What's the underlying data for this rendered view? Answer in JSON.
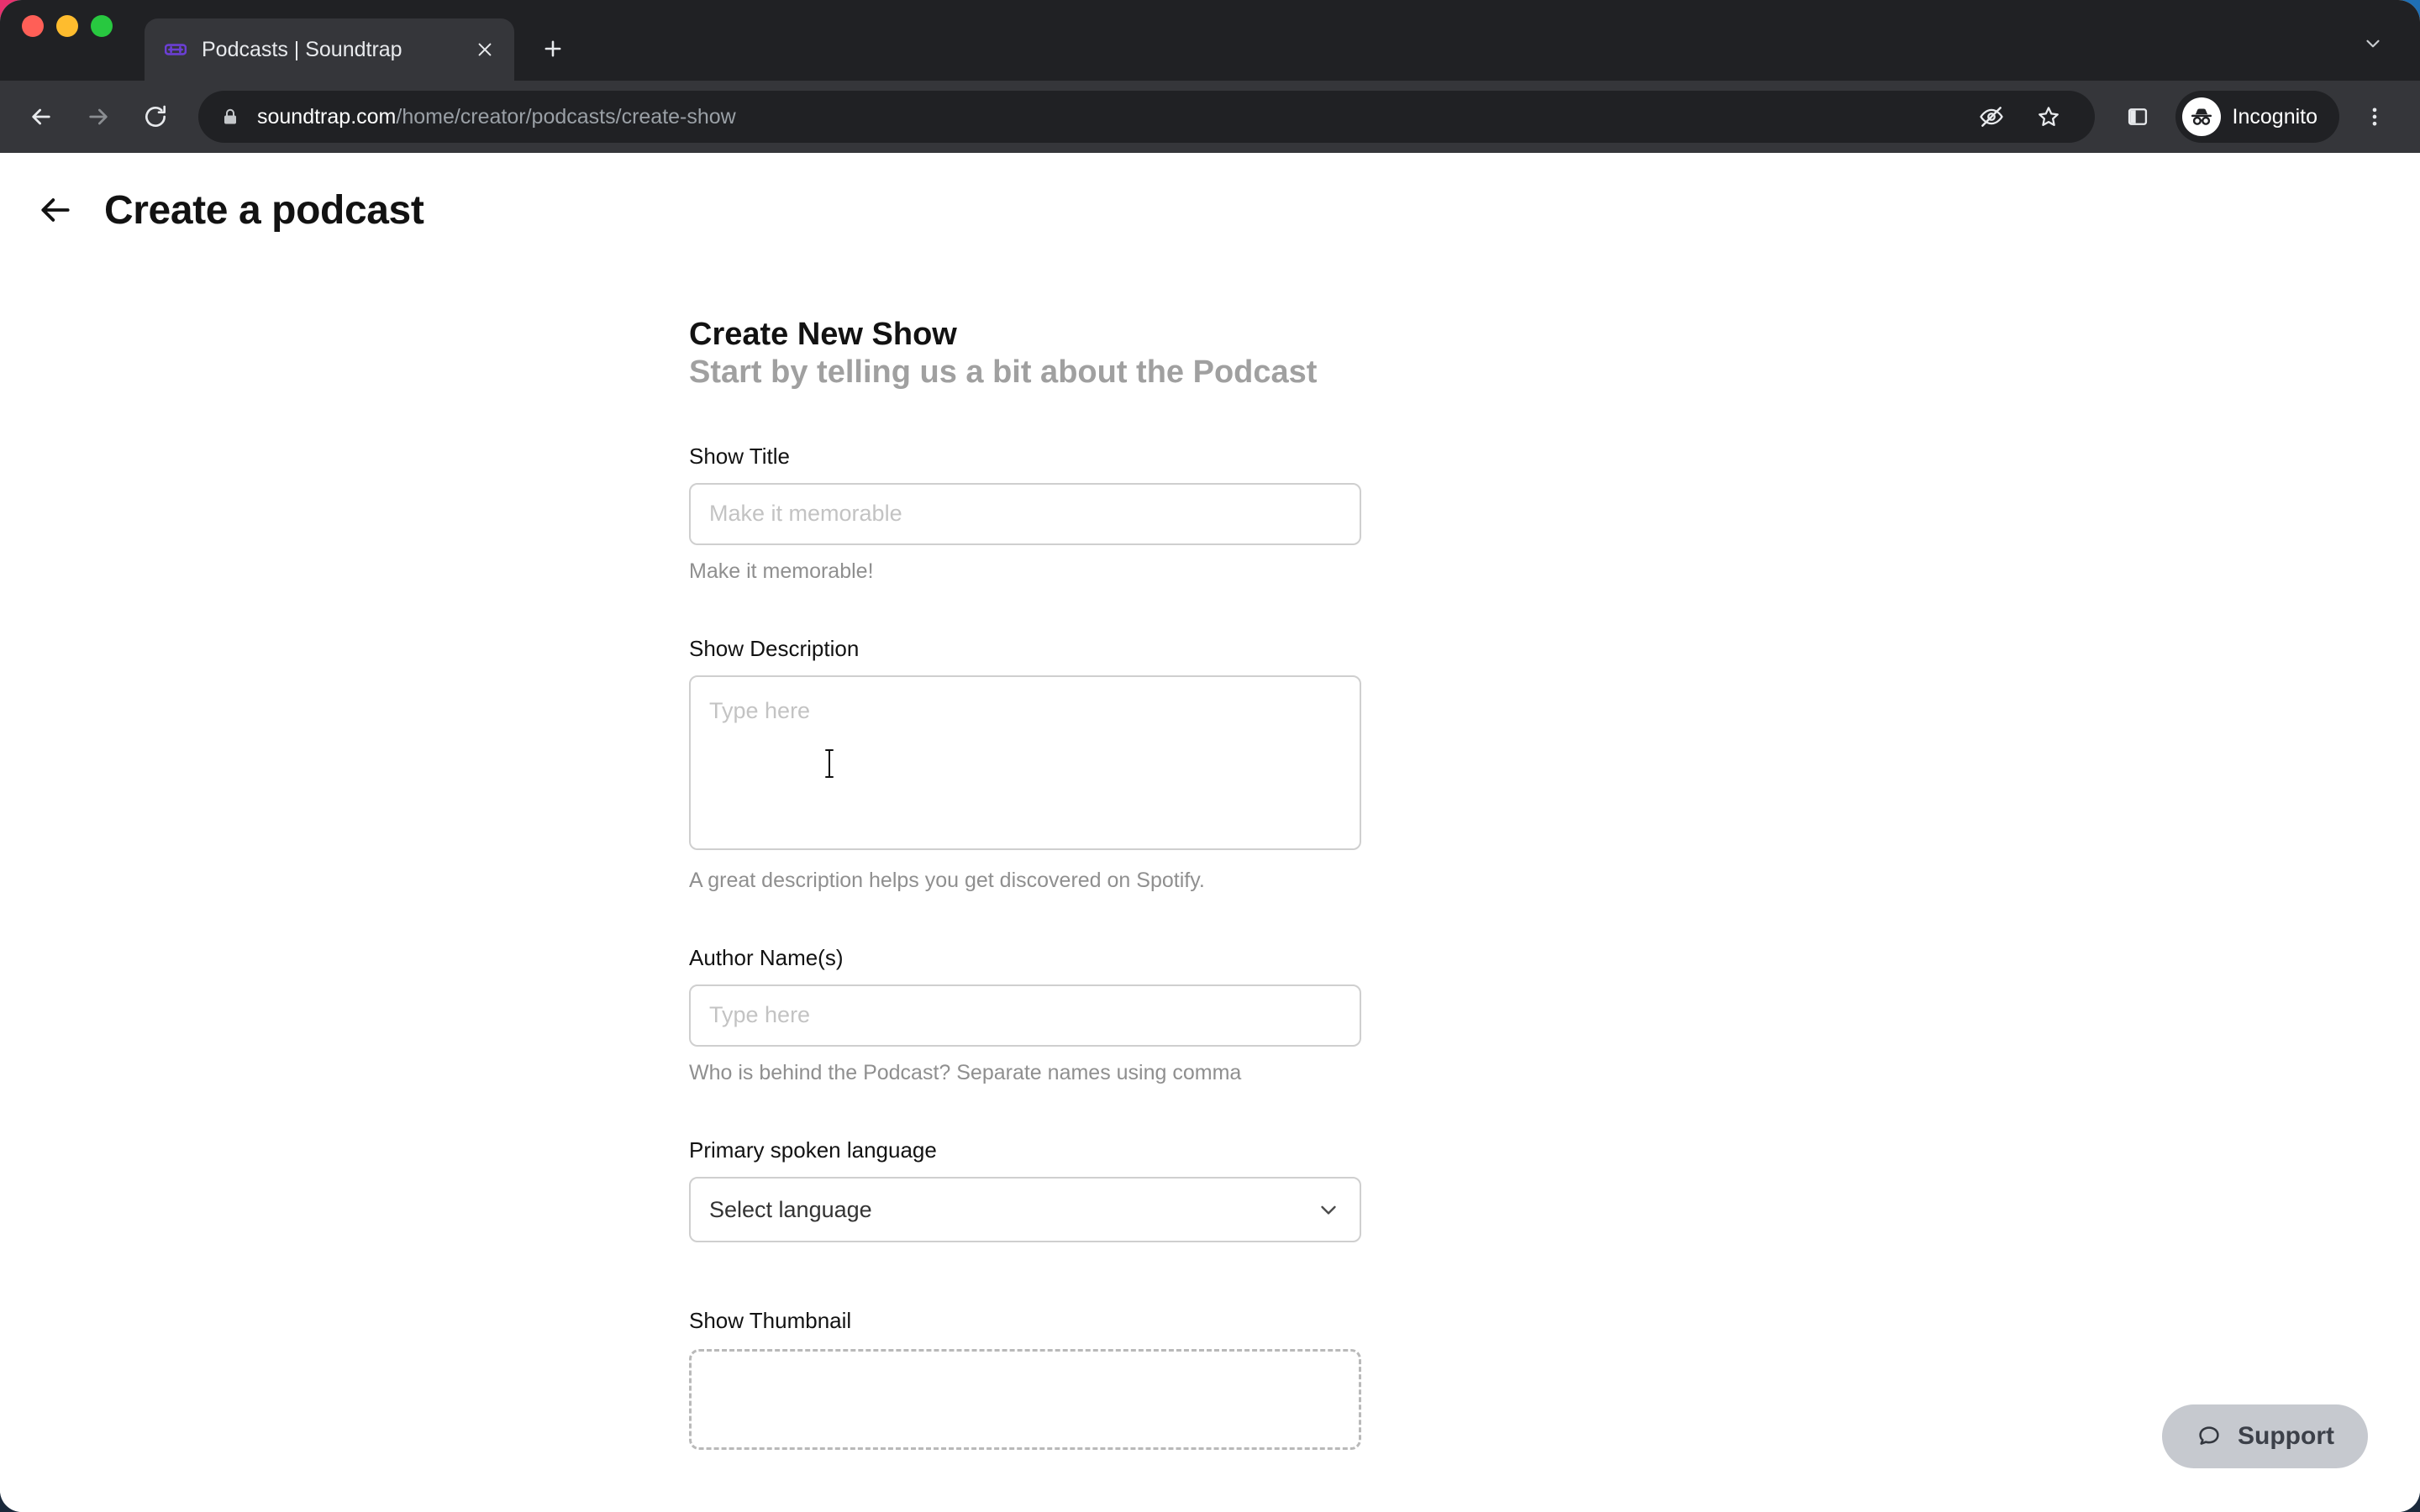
{
  "browser": {
    "tab": {
      "title": "Podcasts | Soundtrap",
      "favicon_name": "soundtrap-favicon",
      "close_label": "×"
    },
    "new_tab_label": "+",
    "tabstrip_menu_name": "tab-list-chevron-icon",
    "toolbar": {
      "back_name": "back-icon",
      "forward_name": "forward-icon",
      "reload_name": "reload-icon",
      "lock_name": "lock-icon",
      "url_host": "soundtrap.com",
      "url_path": "/home/creator/podcasts/create-show",
      "tracking_protection_name": "eye-off-icon",
      "bookmark_name": "star-icon",
      "side_panel_name": "side-panel-icon",
      "profile_label": "Incognito",
      "profile_icon_name": "incognito-icon",
      "menu_name": "three-dot-menu-icon"
    },
    "colors": {
      "tabstrip_bg": "#202124",
      "toolbar_bg": "#35363a",
      "omnibox_bg": "#202124",
      "tab_active_bg": "#35363a",
      "text_primary": "#e8eaed",
      "text_secondary": "#9aa0a6"
    }
  },
  "page": {
    "header": {
      "back_icon_name": "back-arrow-icon",
      "title": "Create a podcast"
    },
    "form": {
      "heading": "Create New Show",
      "subheading": "Start by telling us a bit about the Podcast",
      "fields": [
        {
          "label": "Show Title",
          "placeholder": "Make it memorable",
          "value": "",
          "helper": "Make it memorable!"
        },
        {
          "label": "Show Description",
          "placeholder": "Type here",
          "value": "",
          "helper": "A great description helps you get discovered on Spotify."
        },
        {
          "label": "Author Name(s)",
          "placeholder": "Type here",
          "value": "",
          "helper": "Who is behind the Podcast? Separate names using comma"
        }
      ],
      "language": {
        "label": "Primary spoken language",
        "selected": "Select language",
        "chevron_name": "chevron-down-icon"
      },
      "thumbnail": {
        "label": "Show Thumbnail"
      }
    },
    "support": {
      "label": "Support",
      "icon_name": "chat-bubble-icon",
      "bg_color": "#c6c9cf"
    },
    "colors": {
      "page_bg": "#ffffff",
      "text_primary": "#121212",
      "text_muted": "#8f8f8f",
      "subheading": "#a0a0a0",
      "input_border": "#cfcfcf",
      "placeholder": "#c3c3c3"
    }
  }
}
